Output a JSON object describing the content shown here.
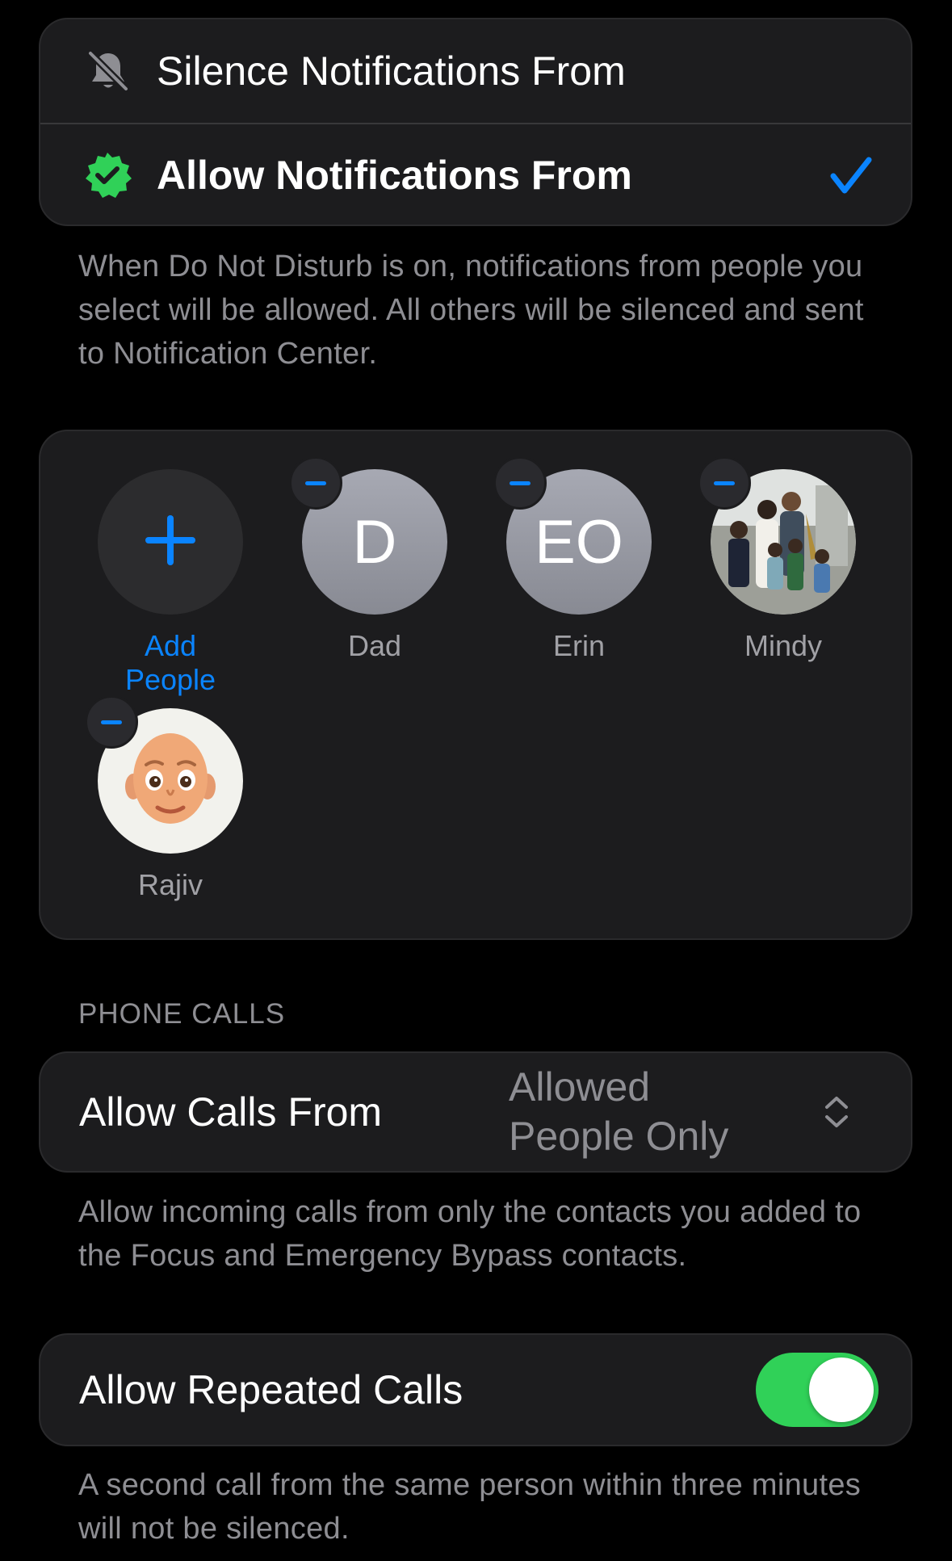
{
  "notification_mode": {
    "silence_label": "Silence Notifications From",
    "allow_label": "Allow Notifications From",
    "selected": "allow"
  },
  "notification_footnote": "When Do Not Disturb is on, notifications from people you select will be allowed. All others will be silenced and sent to Notification Center.",
  "people": {
    "add_label": "Add People",
    "list": [
      {
        "name": "Dad",
        "initials": "D"
      },
      {
        "name": "Erin",
        "initials": "EO"
      },
      {
        "name": "Mindy",
        "avatar": "group-photo"
      },
      {
        "name": "Rajiv",
        "avatar": "memoji"
      }
    ]
  },
  "phone_calls": {
    "section_header": "PHONE CALLS",
    "allow_calls_label": "Allow Calls From",
    "allow_calls_value": "Allowed People Only",
    "allow_calls_footnote": "Allow incoming calls from only the contacts you added to the Focus and Emergency Bypass contacts.",
    "repeated_calls_label": "Allow Repeated Calls",
    "repeated_calls_enabled": true,
    "repeated_calls_footnote": "A second call from the same person within three minutes will not be silenced."
  },
  "colors": {
    "accent_blue": "#0a84ff",
    "toggle_green": "#30d158",
    "allowed_badge_green": "#30d158",
    "card_bg": "#1c1c1e"
  }
}
